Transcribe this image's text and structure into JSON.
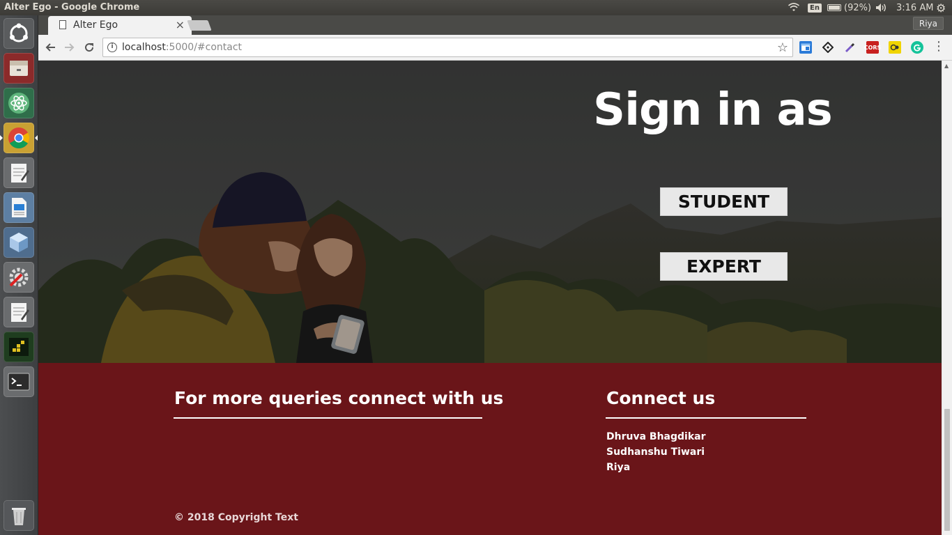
{
  "system": {
    "window_title": "Alter Ego - Google Chrome",
    "keyboard_layout": "En",
    "battery": "(92%)",
    "clock": "3:16 AM"
  },
  "browser": {
    "tab_title": "Alter Ego",
    "profile_name": "Riya",
    "url_host": "localhost",
    "url_rest": ":5000/#contact",
    "extensions": [
      "CORS"
    ]
  },
  "hero": {
    "title": "Sign in as",
    "buttons": [
      "STUDENT",
      "EXPERT"
    ]
  },
  "footer": {
    "left_heading": "For more queries connect with us",
    "right_heading": "Connect us",
    "names": [
      "Dhruva Bhagdikar",
      "Sudhanshu Tiwari",
      "Riya"
    ],
    "copyright": "© 2018 Copyright Text"
  }
}
